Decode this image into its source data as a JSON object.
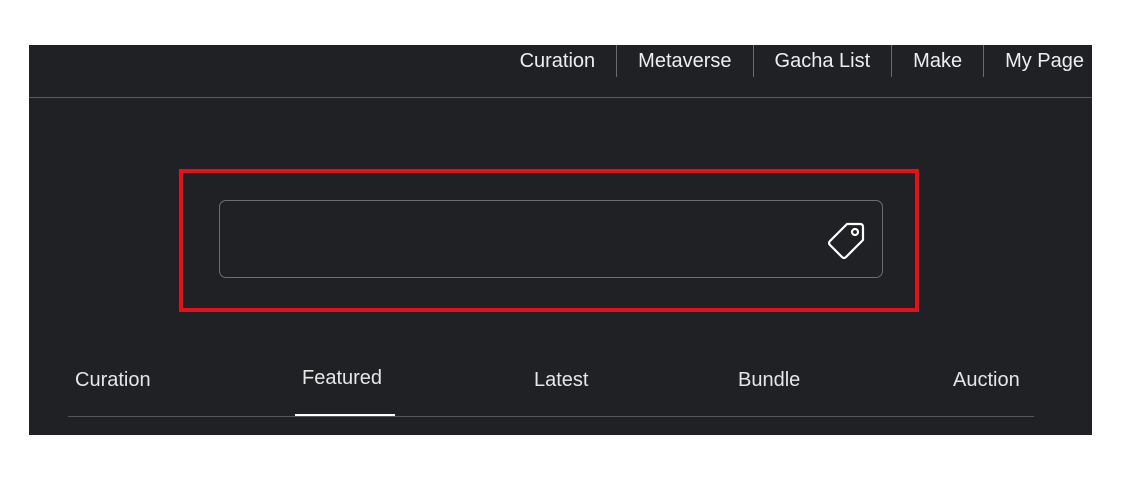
{
  "topnav": {
    "items": [
      {
        "label": "Curation"
      },
      {
        "label": "Metaverse"
      },
      {
        "label": "Gacha List"
      },
      {
        "label": "Make"
      },
      {
        "label": "My Page"
      }
    ]
  },
  "search": {
    "value": "",
    "placeholder": "",
    "icon": "tag-icon"
  },
  "tabs": {
    "items": [
      {
        "label": "Curation"
      },
      {
        "label": "Featured"
      },
      {
        "label": "Latest"
      },
      {
        "label": "Bundle"
      },
      {
        "label": "Auction"
      }
    ],
    "active": "Featured"
  },
  "colors": {
    "background": "#202124",
    "highlight": "#e3111d",
    "text": "#ffffff"
  }
}
